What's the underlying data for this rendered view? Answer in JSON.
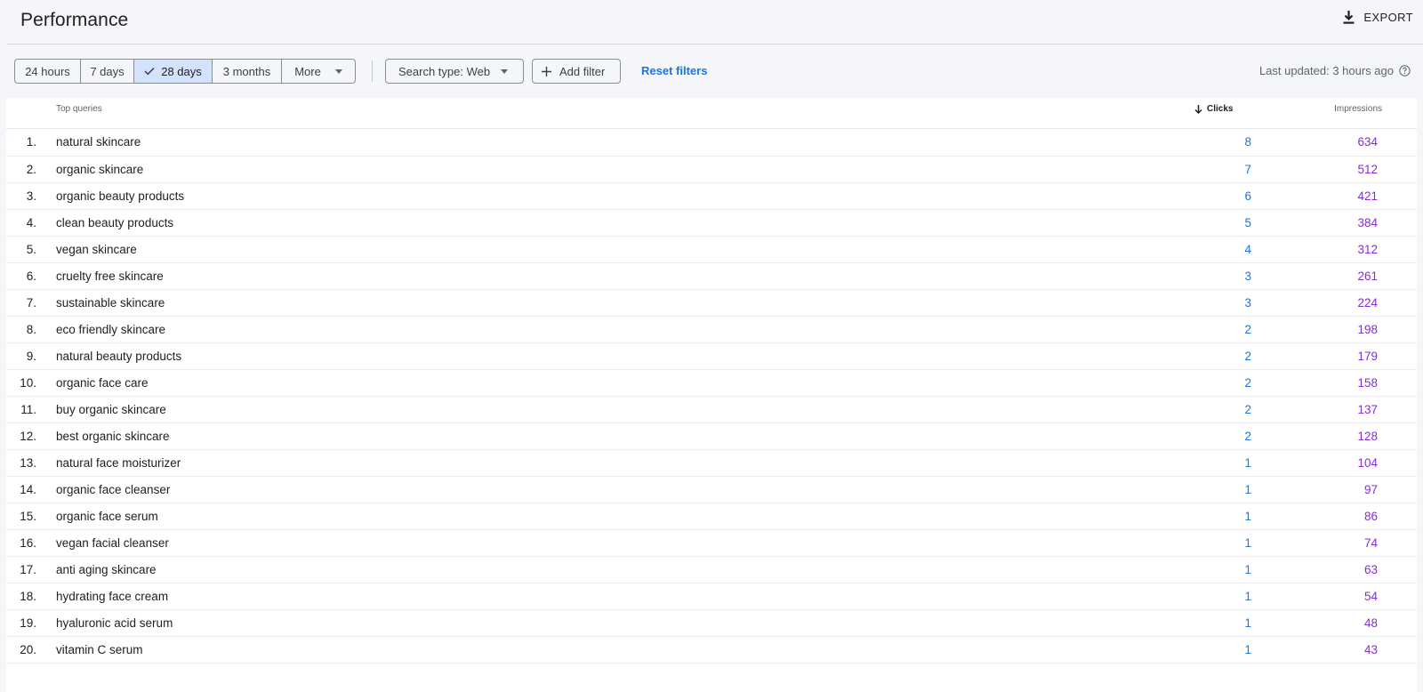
{
  "header": {
    "title": "Performance",
    "export_label": "EXPORT"
  },
  "toolbar": {
    "date_ranges": [
      {
        "label": "24 hours",
        "selected": false
      },
      {
        "label": "7 days",
        "selected": false
      },
      {
        "label": "28 days",
        "selected": true
      },
      {
        "label": "3 months",
        "selected": false
      },
      {
        "label": "More",
        "selected": false
      }
    ],
    "search_type_label": "Search type: Web",
    "add_filter_label": "Add filter",
    "reset_filters_label": "Reset filters",
    "last_updated": "Last updated: 3 hours ago"
  },
  "table": {
    "columns": {
      "query": "Top queries",
      "clicks": "Clicks",
      "impressions": "Impressions"
    },
    "sorted_by": "Clicks",
    "sort_direction": "descending",
    "rows": [
      {
        "rank": "1.",
        "query": "natural skincare",
        "clicks": "8",
        "impressions": "634"
      },
      {
        "rank": "2.",
        "query": "organic skincare",
        "clicks": "7",
        "impressions": "512"
      },
      {
        "rank": "3.",
        "query": "organic beauty products",
        "clicks": "6",
        "impressions": "421"
      },
      {
        "rank": "4.",
        "query": "clean beauty products",
        "clicks": "5",
        "impressions": "384"
      },
      {
        "rank": "5.",
        "query": "vegan skincare",
        "clicks": "4",
        "impressions": "312"
      },
      {
        "rank": "6.",
        "query": "cruelty free skincare",
        "clicks": "3",
        "impressions": "261"
      },
      {
        "rank": "7.",
        "query": "sustainable skincare",
        "clicks": "3",
        "impressions": "224"
      },
      {
        "rank": "8.",
        "query": "eco friendly skincare",
        "clicks": "2",
        "impressions": "198"
      },
      {
        "rank": "9.",
        "query": "natural beauty products",
        "clicks": "2",
        "impressions": "179"
      },
      {
        "rank": "10.",
        "query": "organic face care",
        "clicks": "2",
        "impressions": "158"
      },
      {
        "rank": "11.",
        "query": "buy organic skincare",
        "clicks": "2",
        "impressions": "137"
      },
      {
        "rank": "12.",
        "query": "best organic skincare",
        "clicks": "2",
        "impressions": "128"
      },
      {
        "rank": "13.",
        "query": "natural face moisturizer",
        "clicks": "1",
        "impressions": "104"
      },
      {
        "rank": "14.",
        "query": "organic face cleanser",
        "clicks": "1",
        "impressions": "97"
      },
      {
        "rank": "15.",
        "query": "organic face serum",
        "clicks": "1",
        "impressions": "86"
      },
      {
        "rank": "16.",
        "query": "vegan facial cleanser",
        "clicks": "1",
        "impressions": "74"
      },
      {
        "rank": "17.",
        "query": "anti aging skincare",
        "clicks": "1",
        "impressions": "63"
      },
      {
        "rank": "18.",
        "query": "hydrating face cream",
        "clicks": "1",
        "impressions": "54"
      },
      {
        "rank": "19.",
        "query": "hyaluronic acid serum",
        "clicks": "1",
        "impressions": "48"
      },
      {
        "rank": "20.",
        "query": "vitamin C serum",
        "clicks": "1",
        "impressions": "43"
      }
    ]
  },
  "colors": {
    "clicks": "#1a73e8",
    "impressions": "#8430ce",
    "selected_segment": "#d3e3fd",
    "link": "#1a73e8"
  },
  "icons": {
    "export": "download-icon",
    "selected": "check-icon",
    "dropdown": "caret-down-icon",
    "add": "plus-icon",
    "help": "help-circle-icon",
    "sort": "arrow-down-icon"
  }
}
